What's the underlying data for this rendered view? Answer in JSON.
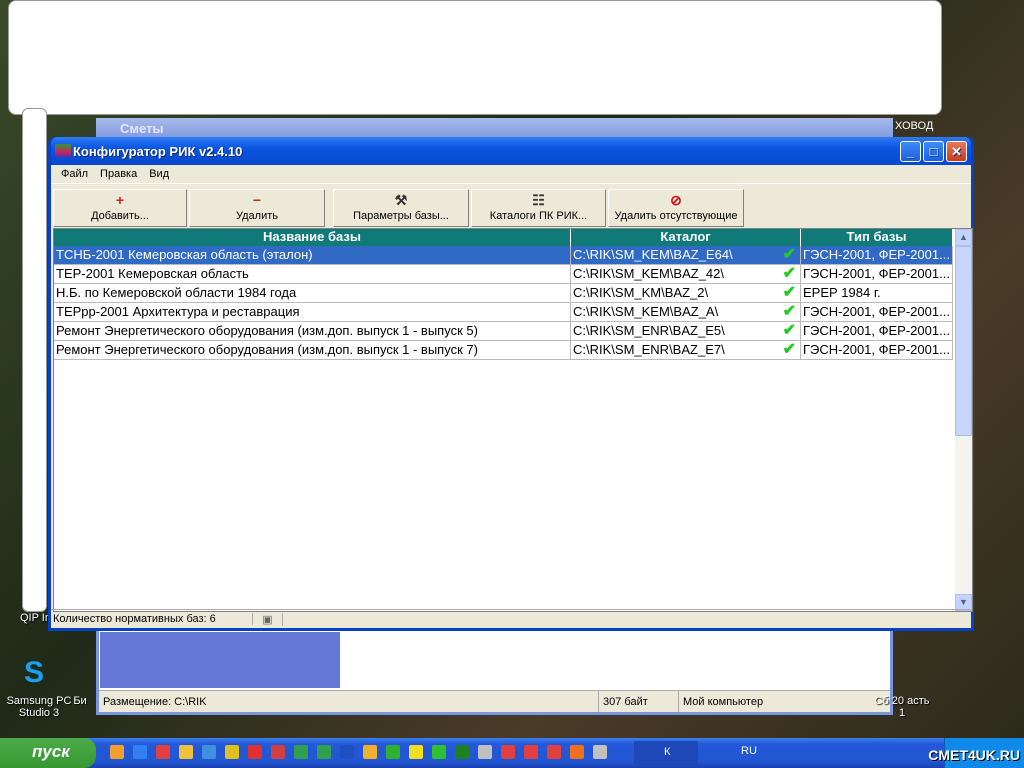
{
  "background": {
    "window_title": "Сметы",
    "desktop_label_right": "ХОВОД",
    "bg_status": {
      "location": "Размещение: C:\\RIK",
      "size": "307 байт",
      "computer": "Мой компьютер"
    },
    "desktop_icons": [
      {
        "label": "QIP Inf"
      },
      {
        "label": "Samsung PC Studio 3"
      },
      {
        "label": "Би"
      },
      {
        "label": "Сб 20 асть 1"
      }
    ]
  },
  "window": {
    "title": "Конфигуратор РИК v2.4.10",
    "controls": {
      "minimize": "_",
      "maximize": "□",
      "close": "✕"
    }
  },
  "menu": [
    "Файл",
    "Правка",
    "Вид"
  ],
  "toolbar": [
    {
      "label": "Добавить...",
      "icon": "add-icon",
      "glyph": "+"
    },
    {
      "label": "Удалить",
      "icon": "remove-icon",
      "glyph": "−"
    },
    {
      "label": "Параметры базы...",
      "icon": "tools-icon",
      "glyph": "⚒"
    },
    {
      "label": "Каталоги ПК РИК...",
      "icon": "catalog-tree-icon",
      "glyph": "☷"
    },
    {
      "label": "Удалить отсутствующие",
      "icon": "no-entry-icon",
      "glyph": "⊘"
    }
  ],
  "table": {
    "columns": [
      "Название базы",
      "Каталог",
      "Тип базы"
    ],
    "rows": [
      {
        "name": "ТСНБ-2001 Кемеровская область (эталон)",
        "catalog": "C:\\RIK\\SM_KEM\\BAZ_E64\\",
        "type": "ГЭСН-2001, ФЕР-2001...",
        "ok": true,
        "selected": true
      },
      {
        "name": "ТЕР-2001 Кемеровская область",
        "catalog": "C:\\RIK\\SM_KEM\\BAZ_42\\",
        "type": "ГЭСН-2001, ФЕР-2001...",
        "ok": true
      },
      {
        "name": "Н.Б. по Кемеровской области 1984 года",
        "catalog": "C:\\RIK\\SM_KM\\BAZ_2\\",
        "type": "ЕРЕР 1984 г.",
        "ok": true
      },
      {
        "name": "ТЕРрр-2001 Архитектура и реставрация",
        "catalog": "C:\\RIK\\SM_KEM\\BAZ_A\\",
        "type": "ГЭСН-2001, ФЕР-2001...",
        "ok": true
      },
      {
        "name": "Ремонт Энергетического оборудования (изм.доп. выпуск 1 - выпуск 5)",
        "catalog": "C:\\RIK\\SM_ENR\\BAZ_E5\\",
        "type": "ГЭСН-2001, ФЕР-2001...",
        "ok": true
      },
      {
        "name": "Ремонт Энергетического оборудования (изм.доп. выпуск 1 - выпуск 7)",
        "catalog": "C:\\RIK\\SM_ENR\\BAZ_E7\\",
        "type": "ГЭСН-2001, ФЕР-2001...",
        "ok": true
      }
    ],
    "check_glyph": "✔"
  },
  "status": {
    "count": "Количество нормативных баз: 6"
  },
  "taskbar": {
    "start": "пуск",
    "task": "К",
    "lang": "RU",
    "watermark": "CMET4UK.RU"
  }
}
